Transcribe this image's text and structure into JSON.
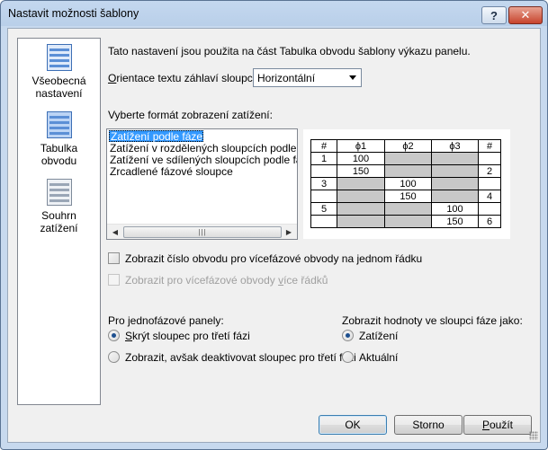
{
  "window": {
    "title": "Nastavit možnosti šablony",
    "help_label": "?",
    "close_label": "✕"
  },
  "nav": [
    {
      "label_line1": "Všeobecná",
      "label_line2": "nastavení",
      "icon": "general-settings-icon",
      "selected": false
    },
    {
      "label_line1": "Tabulka",
      "label_line2": "obvodu",
      "icon": "circuit-table-icon",
      "selected": true
    },
    {
      "label_line1": "Souhrn",
      "label_line2": "zatížení",
      "icon": "load-summary-icon",
      "selected": false
    }
  ],
  "main": {
    "intro": "Tato nastavení jsou použita na část Tabulka obvodu šablony výkazu panelu.",
    "orientation_label_pre": "",
    "orientation_label_u": "O",
    "orientation_label_post": "rientace textu záhlaví sloupce:",
    "orientation_value": "Horizontální",
    "load_format_label": "Vyberte formát zobrazení zatížení:",
    "load_formats": [
      "Zatížení podle fáze",
      "Zatížení v rozdělených sloupcích podle fáze",
      "Zatížení ve sdílených sloupcích podle fáze",
      "Zrcadlené fázové sloupce"
    ],
    "selected_format_index": 0,
    "preview": {
      "headers": [
        "#",
        "ϕ1",
        "ϕ2",
        "ϕ3",
        "#"
      ],
      "rows": [
        [
          "1",
          "100",
          "",
          "",
          ""
        ],
        [
          "",
          "150",
          "",
          "",
          "2"
        ],
        [
          "3",
          "",
          "100",
          "",
          ""
        ],
        [
          "",
          "",
          "150",
          "",
          "4"
        ],
        [
          "5",
          "",
          "",
          "100",
          ""
        ],
        [
          "",
          "",
          "",
          "150",
          "6"
        ]
      ]
    },
    "show_circuit_checkbox_pre": "Zobrazit číslo obvodu pro vícefázové obvody na ",
    "show_circuit_checkbox_u": "j",
    "show_circuit_checkbox_post": "ednom řádku",
    "show_multirow_checkbox_pre": "Zobrazit pro vícefázové obvody ",
    "show_multirow_checkbox_u": "v",
    "show_multirow_checkbox_post": "íce řádků",
    "single_phase_label": "Pro jednofázové panely:",
    "single_phase_opt1_u": "S",
    "single_phase_opt1_post": "krýt sloupec pro třetí fázi",
    "single_phase_opt2": "Zobrazit, avšak deaktivovat sloupec pro třetí fázi",
    "show_values_label": "Zobrazit hodnoty ve sloupci fáze jako:",
    "show_values_opt1": "Zatížení",
    "show_values_opt2": "Aktuální"
  },
  "buttons": {
    "ok": "OK",
    "cancel": "Storno",
    "apply_u": "P",
    "apply_post": "oužít"
  }
}
